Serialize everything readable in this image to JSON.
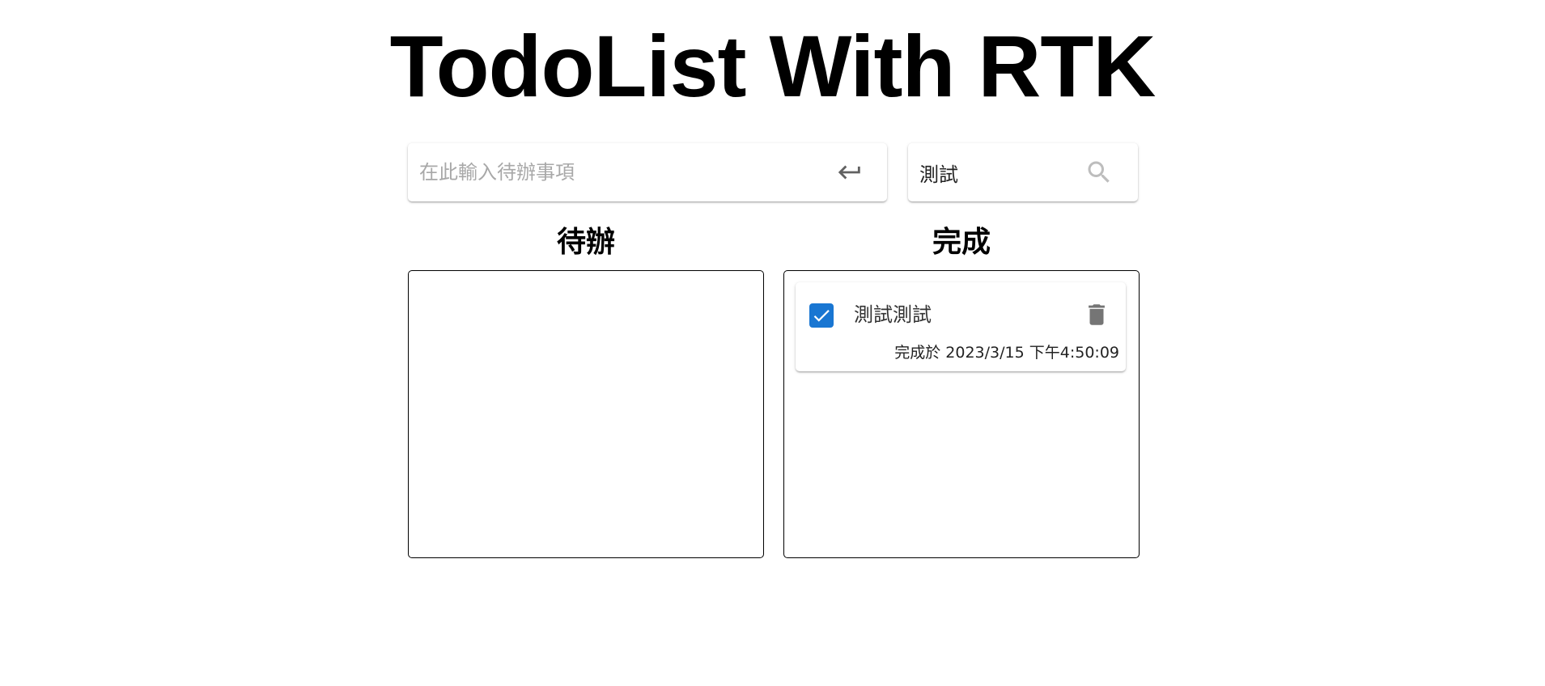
{
  "app": {
    "title": "TodoList With RTK"
  },
  "todo_input": {
    "placeholder": "在此輸入待辦事項",
    "value": "",
    "submit_icon": "enter-icon"
  },
  "search": {
    "value": "測試",
    "icon": "search-icon"
  },
  "columns": {
    "todo": {
      "heading": "待辦",
      "items": []
    },
    "done": {
      "heading": "完成",
      "items": [
        {
          "text": "測試測試",
          "checked": true,
          "completed_at": "完成於 2023/3/15 下午4:50:09",
          "delete_icon": "trash-icon"
        }
      ]
    }
  },
  "colors": {
    "accent": "#1976d2",
    "icon_gray": "#757575",
    "search_icon_gray": "#bdbdbd",
    "border": "#000000"
  }
}
